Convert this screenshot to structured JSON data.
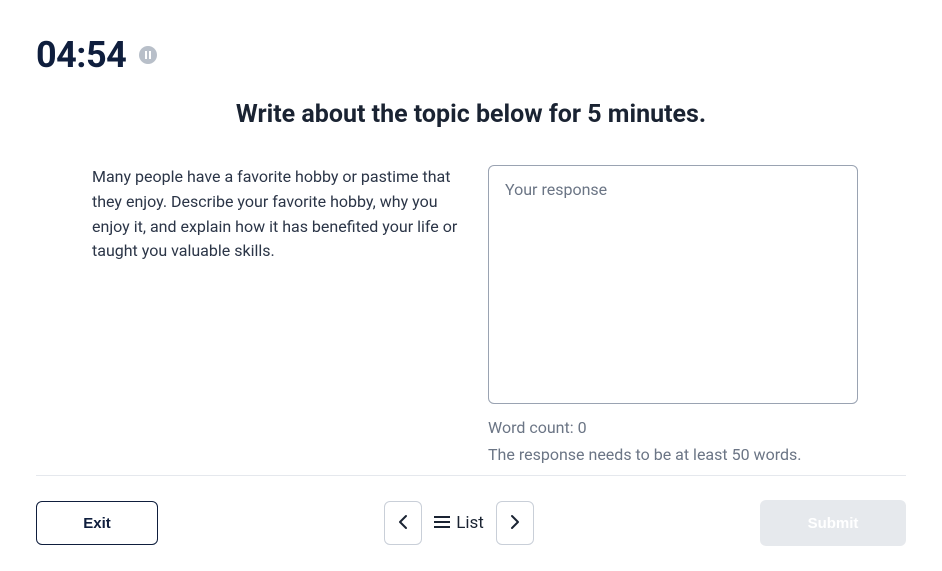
{
  "timer": "04:54",
  "instruction": "Write about the topic below for 5 minutes.",
  "prompt": "Many people have a favorite hobby or pastime that they enjoy. Describe your favorite hobby, why you enjoy it, and explain how it has benefited your life or taught you valuable skills.",
  "response": {
    "placeholder": "Your response",
    "value": ""
  },
  "word_count_label": "Word count: 0",
  "word_hint": "The response needs to be at least 50 words.",
  "footer": {
    "exit": "Exit",
    "list": "List",
    "submit": "Submit"
  }
}
